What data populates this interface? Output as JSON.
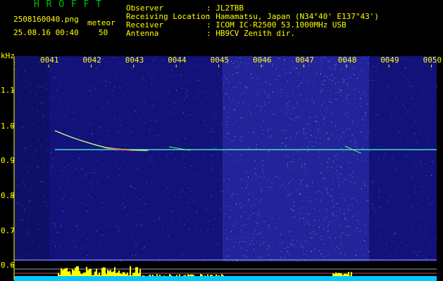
{
  "app_title": "H R O F F T",
  "file_name": "2508160040.png",
  "timestamp": "25.08.16 00:40",
  "mode_label": "meteor",
  "mode_value": "50",
  "info": {
    "labels": [
      "Observer",
      "Receiving Location",
      "Receiver",
      "Antenna"
    ],
    "values": [
      ": JL2TBB",
      ": Hamamatsu, Japan (N34°40' E137°43')",
      ": ICOM IC-R2500 53.1000MHz USB",
      ": HB9CV Zenith dir."
    ]
  },
  "y_unit": "kHz",
  "y_ticks": [
    "1.1",
    "1.0",
    "0.9",
    "0.8",
    "0.7",
    "0.6"
  ],
  "time_ticks": [
    "0041",
    "0042",
    "0043",
    "0044",
    "0045",
    "0046",
    "0047",
    "0048",
    "0049",
    "0050"
  ],
  "colors": {
    "title": "#00c000",
    "text": "#ffff00",
    "background": "#000000",
    "spectrogram_base": "#12127a",
    "carrier": "#40e0d0",
    "meteor_trace": "#c0ff80",
    "level_bars": "#ffff00",
    "noise_floor": "#00c8ff"
  }
}
